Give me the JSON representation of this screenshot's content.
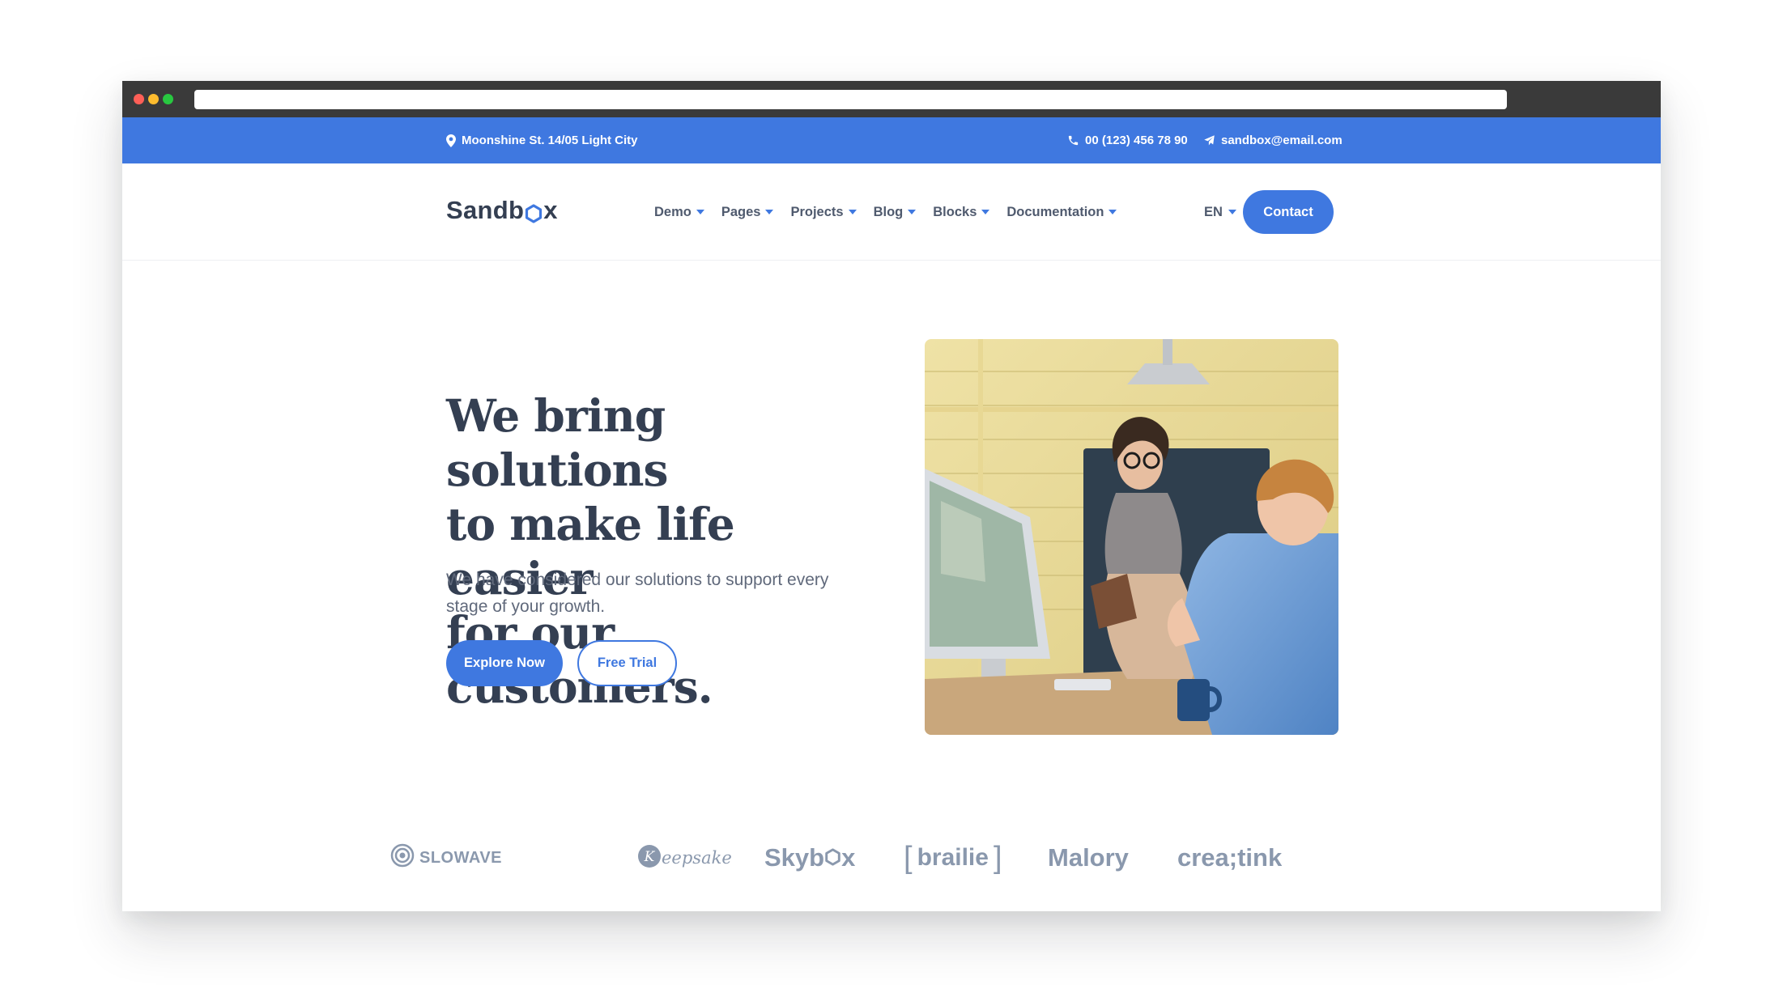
{
  "topbar": {
    "address": "Moonshine St. 14/05 Light City",
    "phone": "00 (123) 456 78 90",
    "email": "sandbox@email.com",
    "icons": [
      "map-pin-icon",
      "phone-icon",
      "send-icon"
    ]
  },
  "navbar": {
    "logo": {
      "pre": "Sandb",
      "post": "x"
    },
    "items": [
      {
        "label": "Demo"
      },
      {
        "label": "Pages"
      },
      {
        "label": "Projects"
      },
      {
        "label": "Blog"
      },
      {
        "label": "Blocks"
      },
      {
        "label": "Documentation"
      }
    ],
    "language": "EN",
    "contact_label": "Contact"
  },
  "hero": {
    "title_lines": [
      "We bring solutions",
      "to make life easier",
      "for our customers."
    ],
    "subtitle": "We have considered our solutions to support every stage of your growth.",
    "primary_button": "Explore Now",
    "secondary_button": "Free Trial"
  },
  "clients": {
    "slowave": "SLOWAVE",
    "keepsake": "eepsake",
    "skybox": {
      "pre": "Skyb",
      "post": "x"
    },
    "brailie": "brailie",
    "malory": "Malory",
    "creatink": "crea;tink"
  },
  "colors": {
    "primary": "#3f78e0",
    "heading": "#343f52",
    "body": "#60697b",
    "muted_logo": "#8a98ad",
    "chrome": "#3a3a3a"
  }
}
